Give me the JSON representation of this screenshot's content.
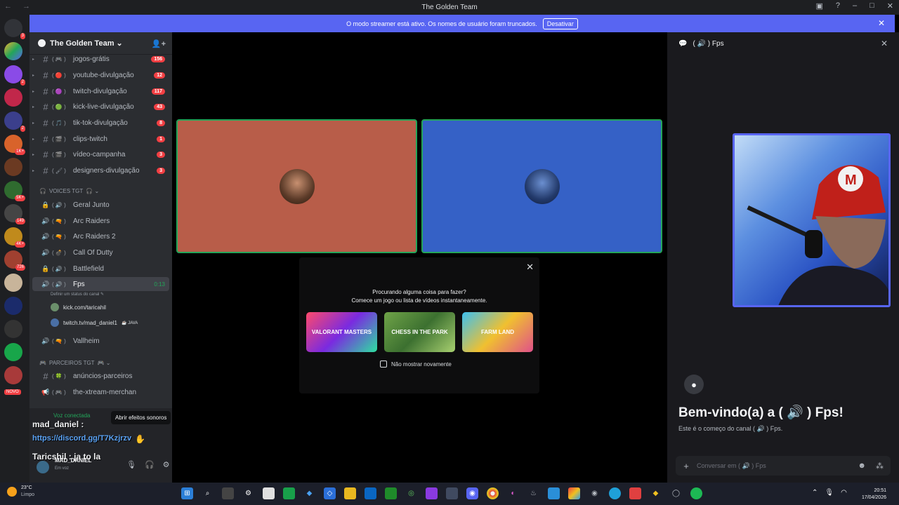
{
  "window": {
    "title": "The Golden Team",
    "nav": "←  →"
  },
  "banner": {
    "text": "O modo streamer está ativo. Os nomes de usuário foram truncados.",
    "button": "Desativar"
  },
  "guilds": {
    "badges": [
      "3",
      "2",
      "2",
      "1K+",
      "5K+",
      "149",
      "4K+",
      "726"
    ],
    "novo": "NOVO"
  },
  "server": {
    "name": "The Golden Team ⌄"
  },
  "text_channels": [
    {
      "emoji": "( 🎮 )",
      "name": "jogos-grátis",
      "count": "156"
    },
    {
      "emoji": "( 🔴 )",
      "name": "youtube-divulgação",
      "count": "12"
    },
    {
      "emoji": "( 🟣 )",
      "name": "twitch-divulgação",
      "count": "117"
    },
    {
      "emoji": "( 🟢 )",
      "name": "kick-live-divulgação",
      "count": "43"
    },
    {
      "emoji": "( 🎵 )",
      "name": "tik-tok-divulgação",
      "count": "8"
    },
    {
      "emoji": "( 🎬 )",
      "name": "clips-twitch",
      "count": "1"
    },
    {
      "emoji": "( 🎬 )",
      "name": "vídeo-campanha",
      "count": "3"
    },
    {
      "emoji": "( 🖌 )",
      "name": "designers-divulgação",
      "count": "3"
    }
  ],
  "voice_category": {
    "label": "VOICES TGT",
    "icon": "🎧 ⌄"
  },
  "voice_channels": [
    {
      "emoji": "( 🔊 )",
      "name": "Geral Junto"
    },
    {
      "emoji": "( 🔫 )",
      "name": "Arc Raiders"
    },
    {
      "emoji": "( 🔫 )",
      "name": "Arc Raiders 2"
    },
    {
      "emoji": "( 💣 )",
      "name": "Call Of Dutty"
    },
    {
      "emoji": "( 🔊 )",
      "name": "Battlefield"
    },
    {
      "emoji": "( 🔊 )",
      "name": "Fps",
      "time": "0:13",
      "status": "Definir um status do canal ✎"
    },
    {
      "emoji": "( 🔫 )",
      "name": "Vallheim"
    }
  ],
  "voice_users": [
    {
      "name": "kick.com/taricahil",
      "extra": ""
    },
    {
      "name": "twitch.tv/mad_daniel1",
      "extra": "☕ JAVA"
    }
  ],
  "partners_category": {
    "label": "PARCEIROS TGT",
    "icon": "🎮 ⌄"
  },
  "partner_channels": [
    {
      "emoji": "( 🍀 )",
      "name": "anúncios-parceiros"
    },
    {
      "emoji": "( 🎮 )",
      "name": "the-xtream-merchan"
    }
  ],
  "panel": {
    "voice_connected": "Voz conectada",
    "overlay1": "mad_daniel :",
    "overlay2": "https://discord.gg/T7Kzjrzv",
    "overlay3": "Taricshil : ja to la",
    "tooltip": "Abrir efeitos sonoros",
    "username": "MAD_DANIEL",
    "user_status": "Em voz"
  },
  "activity": {
    "line1": "Procurando alguma coisa para fazer?",
    "line2": "Comece um jogo ou lista de vídeos instantaneamente.",
    "games": [
      "VALORANT MASTERS",
      "CHESS IN THE PARK",
      "FARM LAND"
    ],
    "checkbox": "Não mostrar novamente"
  },
  "right_panel": {
    "header": "( 🔊 )  Fps",
    "welcome": "Bem-vindo(a) a ( 🔊 ) Fps!",
    "sub": "Este é o começo do canal ( 🔊 ) Fps.",
    "input_placeholder": "Conversar em ( 🔊 ) Fps"
  },
  "taskbar": {
    "temp": "23°C",
    "weather": "Limpo",
    "time": "20:51",
    "date": "17/04/2026"
  },
  "colors": {
    "accent": "#5865f2",
    "green": "#23a559",
    "red": "#f23f43",
    "tile1": "#b85d49",
    "tile2": "#3561c6"
  }
}
